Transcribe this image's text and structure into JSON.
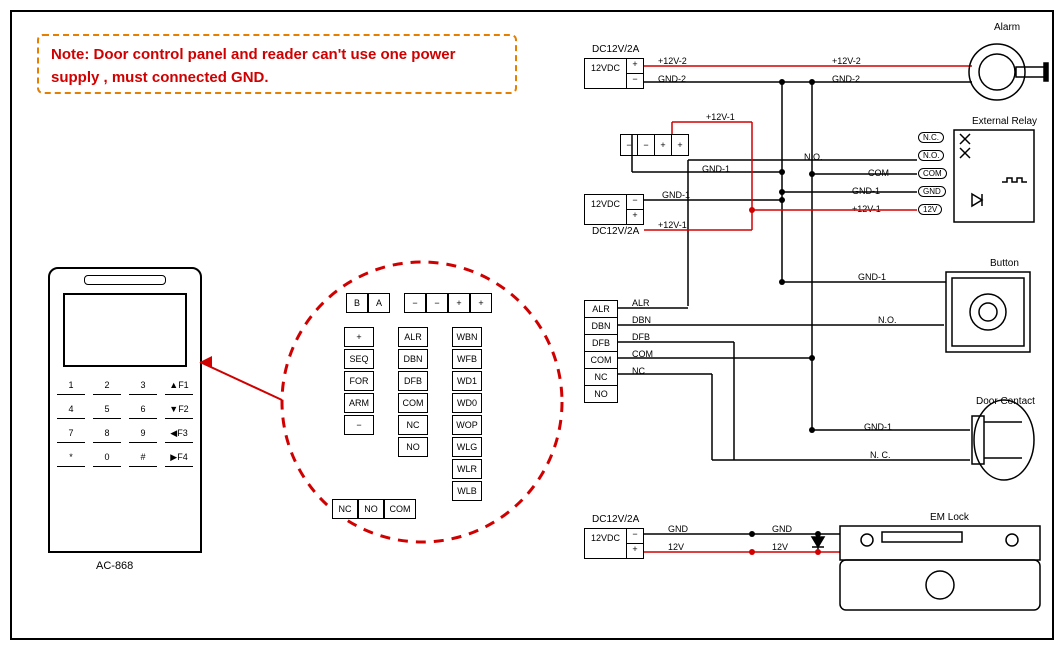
{
  "note": {
    "text": "Note:  Door control panel and  reader can't use one power supply , must connected GND."
  },
  "device": {
    "model": "AC-868",
    "keys_row1": [
      "1",
      "2",
      "3",
      "▲F1"
    ],
    "keys_row2": [
      "4",
      "5",
      "6",
      "▼F2"
    ],
    "keys_row3": [
      "7",
      "8",
      "9",
      "◀F3"
    ],
    "keys_row4": [
      "*",
      "0",
      "#",
      "▶F4"
    ]
  },
  "pins": {
    "top_row_ba": [
      "B",
      "A"
    ],
    "top_row_power": [
      "−",
      "−",
      "+",
      "+"
    ],
    "col1": [
      "+",
      "SEQ",
      "FOR",
      "ARM",
      "−"
    ],
    "col2": [
      "ALR",
      "DBN",
      "DFB",
      "COM",
      "NC",
      "NO"
    ],
    "col3": [
      "WBN",
      "WFB",
      "WD1",
      "WD0",
      "WOP",
      "WLG",
      "WLR",
      "WLB"
    ],
    "bottom_row": [
      "NC",
      "NO",
      "COM"
    ]
  },
  "power_supplies": {
    "ps1_label": "DC12V/2A",
    "ps1_text": "12VDC",
    "ps2_label": "DC12V/2A",
    "ps2_text": "12VDC",
    "ps3_label": "DC12V/2A",
    "ps3_text": "12VDC",
    "pwr_block": [
      "−",
      "−",
      "+",
      "+"
    ]
  },
  "signals": {
    "plus12_2": "+12V-2",
    "gnd_2": "GND-2",
    "plus12_1": "+12V-1",
    "gnd_1": "GND-1",
    "no": "N.O.",
    "nc": "N. C.",
    "com": "COM",
    "gnd": "GND",
    "v12": "12V",
    "alr": "ALR",
    "dbn": "DBN",
    "dfb": "DFB",
    "ncs": "NC",
    "nos": "NO"
  },
  "terminals": {
    "alarm_block": [
      "ALR",
      "DBN",
      "DFB",
      "COM",
      "NC",
      "NO"
    ]
  },
  "relay": {
    "pins": [
      "N.C.",
      "N.O.",
      "COM",
      "GND",
      "12V"
    ]
  },
  "sections": {
    "alarm": "Alarm",
    "external_relay": "External Relay",
    "button": "Button",
    "door_contact": "Door Contact",
    "em_lock": "EM Lock"
  }
}
